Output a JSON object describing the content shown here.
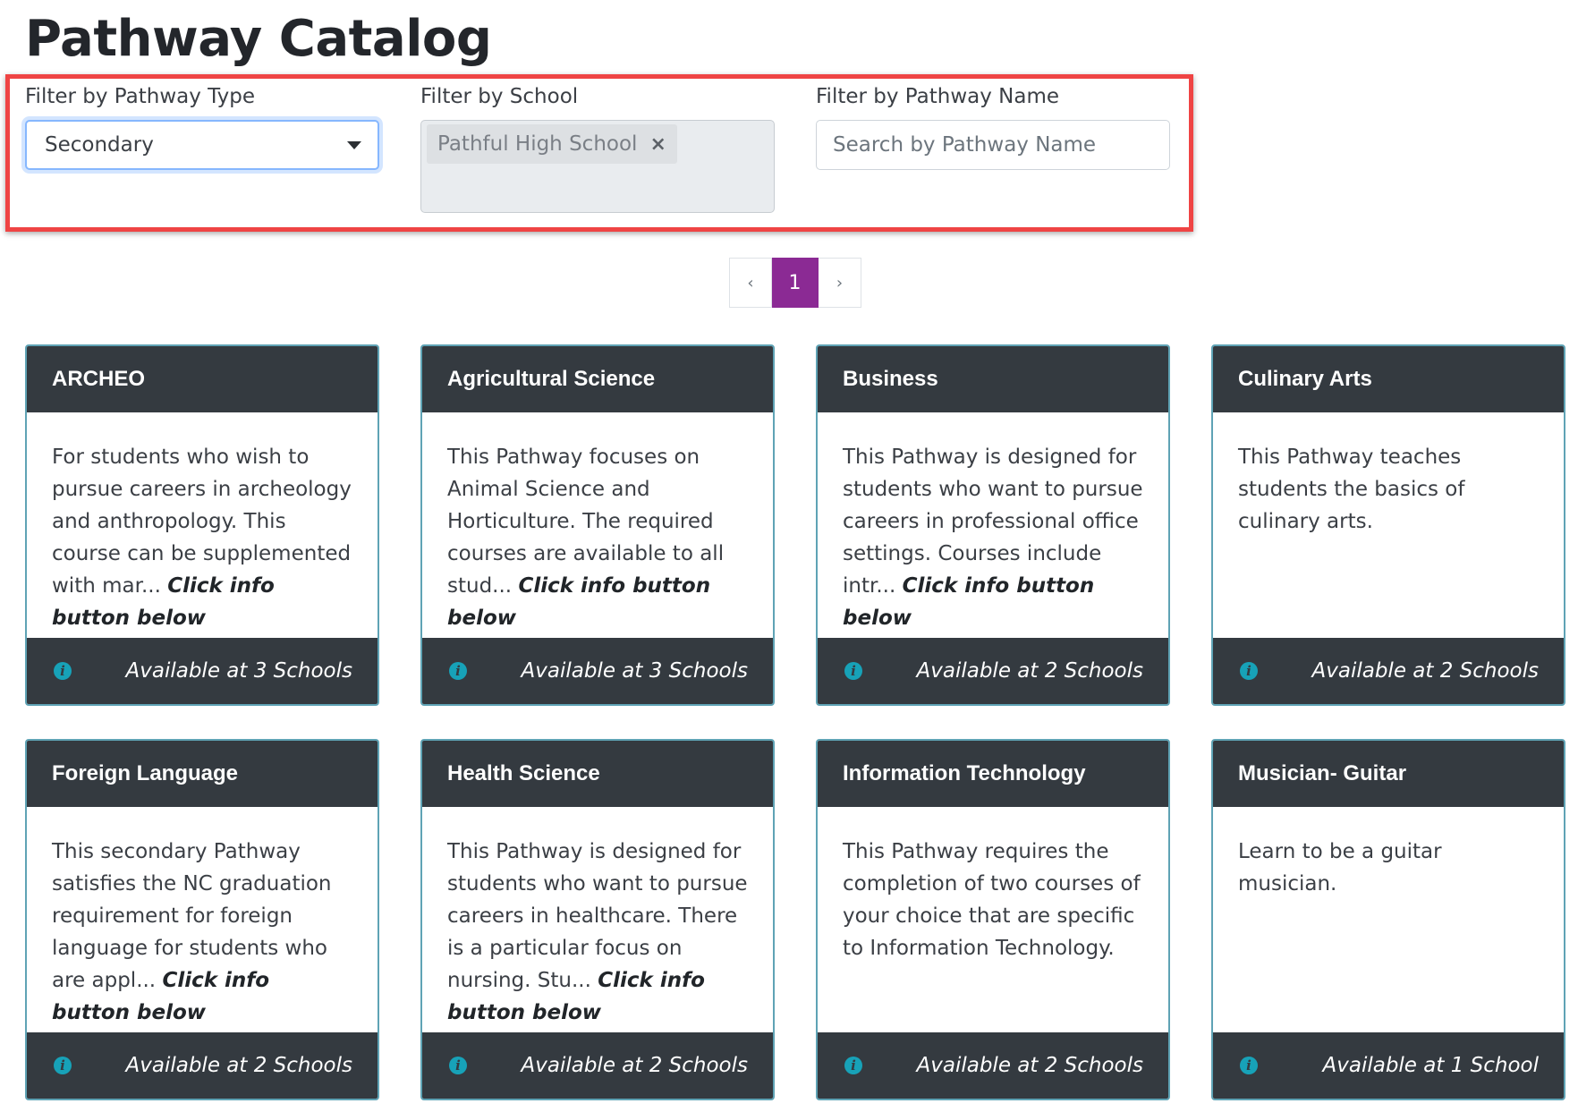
{
  "page": {
    "title": "Pathway Catalog"
  },
  "filters": {
    "type": {
      "label": "Filter by Pathway Type",
      "value": "Secondary"
    },
    "school": {
      "label": "Filter by School",
      "chip": "Pathful High School",
      "chip_remove": "×"
    },
    "name": {
      "label": "Filter by Pathway Name",
      "placeholder": "Search by Pathway Name"
    }
  },
  "pagination": {
    "prev": "‹",
    "current": "1",
    "next": "›"
  },
  "more_text": "Click info button below",
  "cards": [
    {
      "title": "ARCHEO",
      "desc": "For students who wish to pursue careers in archeology and anthropology. This course can be supplemented with mar...",
      "availability": "Available at 3 Schools"
    },
    {
      "title": "Agricultural Science",
      "desc": "This Pathway focuses on Animal Science and Horticulture. The required courses are available to all stud...",
      "availability": "Available at 3 Schools"
    },
    {
      "title": "Business",
      "desc": "This Pathway is designed for students who want to pursue careers in professional office settings. Courses include intr...",
      "availability": "Available at 2 Schools"
    },
    {
      "title": "Culinary Arts",
      "desc": "This Pathway teaches students the basics of culinary arts.",
      "availability": "Available at 2 Schools"
    },
    {
      "title": "Foreign Language",
      "desc": "This secondary Pathway satisfies the NC graduation requirement for foreign language for students who are appl...",
      "availability": "Available at 2 Schools"
    },
    {
      "title": "Health Science",
      "desc": "This Pathway is designed for students who want to pursue careers in healthcare. There is a particular focus on nursing. Stu...",
      "availability": "Available at 2 Schools"
    },
    {
      "title": "Information Technology",
      "desc": "This Pathway requires the completion of two courses of your choice that are specific to Information Technology.",
      "availability": "Available at 2 Schools"
    },
    {
      "title": "Musician- Guitar",
      "desc": "Learn to be a guitar musician.",
      "availability": "Available at 1 School"
    }
  ]
}
